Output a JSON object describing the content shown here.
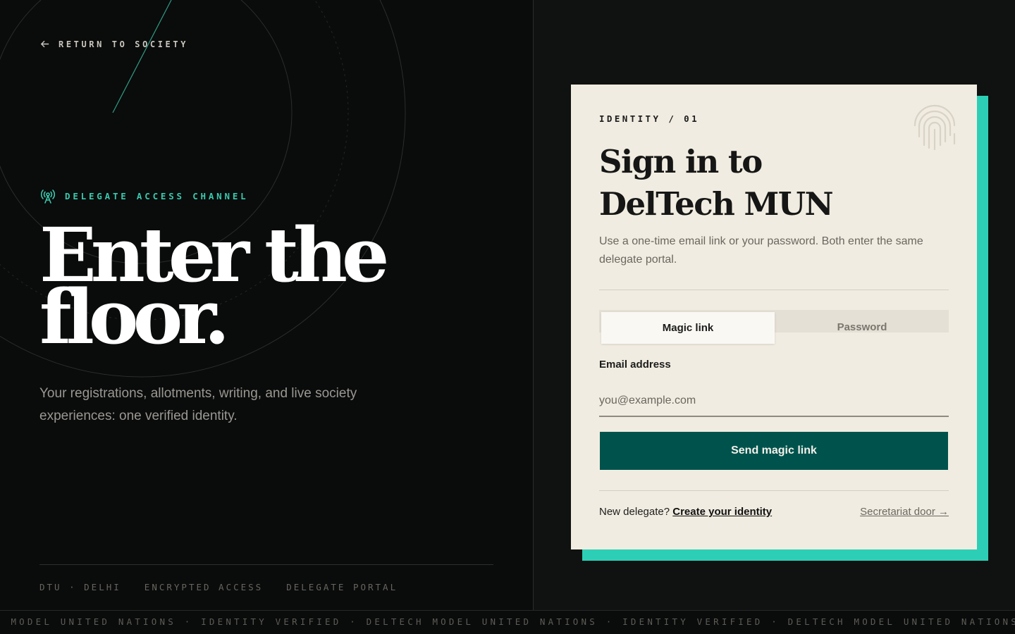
{
  "nav": {
    "return_label": "RETURN TO SOCIETY",
    "return_icon": "arrow-left-icon"
  },
  "hero": {
    "eyebrow": "DELEGATE ACCESS CHANNEL",
    "eyebrow_icon": "broadcast-tower-icon",
    "headline_line1": "Enter the",
    "headline_line2": "floor.",
    "subtitle": "Your registrations, allotments, writing, and live society experiences: one verified identity."
  },
  "footer_tags": [
    "DTU · DELHI",
    "ENCRYPTED ACCESS",
    "DELEGATE PORTAL"
  ],
  "ticker": {
    "text": "H MODEL UNITED NATIONS · IDENTITY VERIFIED · DELTECH MODEL UNITED NATIONS · IDENTITY VERIFIED · DELTECH MODEL UNITED NATIONS"
  },
  "card": {
    "eyebrow": "IDENTITY / 01",
    "title_line1": "Sign in to",
    "title_line2": "DelTech MUN",
    "description": "Use a one-time email link or your password. Both enter the same delegate portal.",
    "tabs": [
      {
        "label": "Magic link",
        "active": true
      },
      {
        "label": "Password",
        "active": false
      }
    ],
    "email_label": "Email address",
    "email_placeholder": "you@example.com",
    "email_value": "",
    "submit_label": "Send magic link",
    "signup_prompt": "New delegate?",
    "signup_link": "Create your identity",
    "secretariat_link": "Secretariat door →",
    "decor_icon": "fingerprint-icon"
  },
  "colors": {
    "accent_teal": "#2ccfb6",
    "primary_button": "#00534d",
    "card_bg": "#f1ece1",
    "page_bg": "#0a0b0b",
    "eyebrow_teal": "#39c9ad"
  }
}
